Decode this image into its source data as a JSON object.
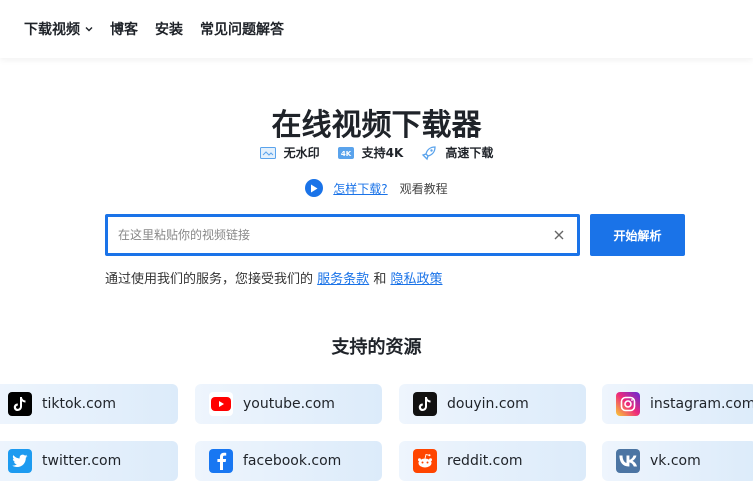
{
  "nav": {
    "download_video": "下载视频",
    "blog": "博客",
    "install": "安装",
    "faq": "常见问题解答"
  },
  "hero": {
    "title": "在线视频下载器",
    "features": [
      "无水印",
      "支持4K",
      "高速下载"
    ]
  },
  "howto": {
    "link": "怎样下载?",
    "text": "观看教程"
  },
  "search": {
    "placeholder": "在这里粘贴你的视频链接",
    "value": "",
    "button": "开始解析"
  },
  "terms": {
    "prefix": "通过使用我们的服务，您接受我们的",
    "service_terms": "服务条款",
    "and": "和",
    "privacy": "隐私政策"
  },
  "sources": {
    "title": "支持的资源",
    "items": [
      "tiktok.com",
      "youtube.com",
      "douyin.com",
      "instagram.com",
      "twitter.com",
      "facebook.com",
      "reddit.com",
      "vk.com"
    ]
  },
  "colors": {
    "accent": "#1a73e8"
  }
}
